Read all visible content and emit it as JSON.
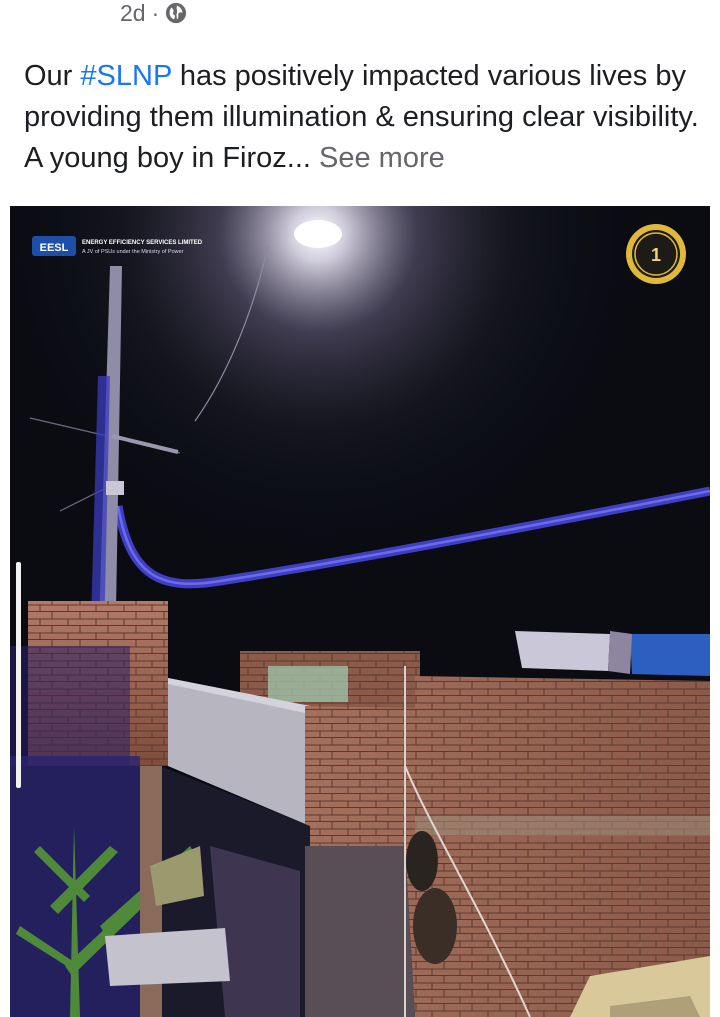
{
  "post": {
    "timestamp": "2d",
    "separator": "·",
    "privacy_icon": "globe-icon",
    "text_before": "Our ",
    "hashtag": "#SLNP",
    "text_after": " has positively impacted various lives by providing them illumination & ensuring clear visibility. A young boy in Firoz...",
    "see_more_label": "See more"
  },
  "photo": {
    "logo_text": "EESL",
    "org_name": "ENERGY EFFICIENCY SERVICES LIMITED",
    "org_subtitle": "A JV of PSUs under the Ministry of Power",
    "badge_icon": "anniversary-badge-icon"
  },
  "colors": {
    "hashtag": "#1877f2",
    "secondary_text": "#65676b",
    "body_text": "#1c1e21"
  }
}
